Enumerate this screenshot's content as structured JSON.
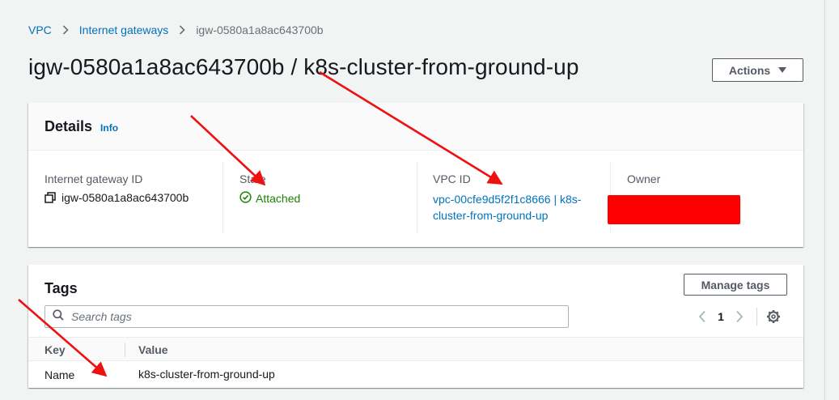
{
  "breadcrumb": {
    "items": [
      "VPC",
      "Internet gateways"
    ],
    "current": "igw-0580a1a8ac643700b"
  },
  "page": {
    "title": "igw-0580a1a8ac643700b / k8s-cluster-from-ground-up",
    "actions_label": "Actions"
  },
  "details": {
    "title": "Details",
    "info_label": "Info",
    "gateway_id_label": "Internet gateway ID",
    "gateway_id_value": "igw-0580a1a8ac643700b",
    "state_label": "State",
    "state_value": "Attached",
    "vpc_id_label": "VPC ID",
    "vpc_id_value": "vpc-00cfe9d5f2f1c8666 | k8s-cluster-from-ground-up",
    "owner_label": "Owner"
  },
  "tags": {
    "title": "Tags",
    "manage_label": "Manage tags",
    "search_placeholder": "Search tags",
    "page_number": "1",
    "columns": [
      "Key",
      "Value"
    ],
    "rows": [
      {
        "key": "Name",
        "value": "k8s-cluster-from-ground-up"
      }
    ]
  },
  "colors": {
    "link": "#0073bb",
    "success": "#1d8102",
    "annotation": "#ff0000",
    "redaction": "#ff0000"
  },
  "icons": [
    "chevron-right-icon",
    "copy-icon",
    "check-circle-icon",
    "search-icon",
    "chevron-left-icon",
    "gear-icon",
    "caret-down-icon"
  ]
}
